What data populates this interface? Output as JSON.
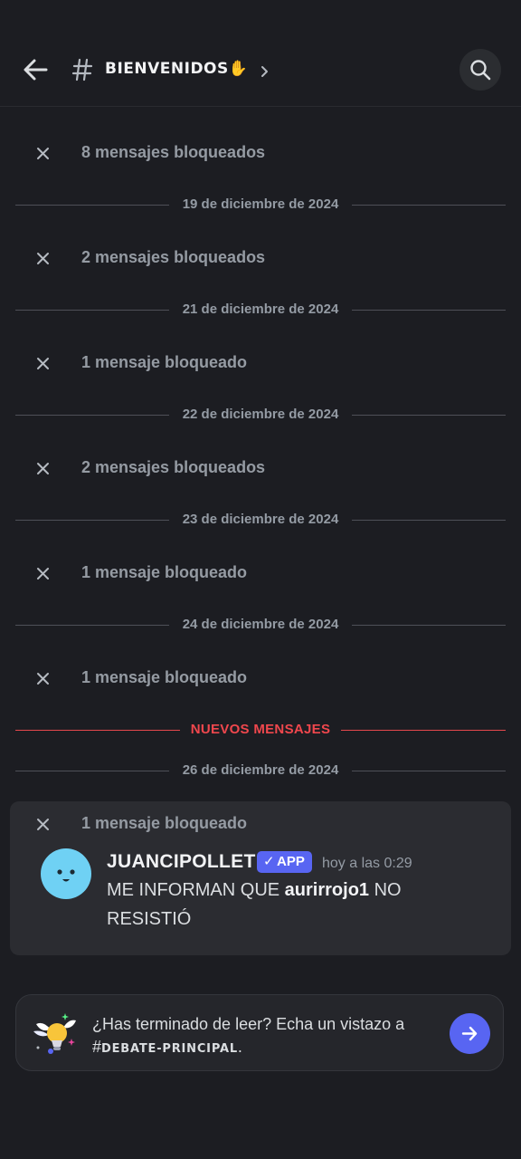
{
  "header": {
    "channel_name": "BIENVENIDOS✋"
  },
  "feed": {
    "blocked_groups": [
      "8 mensajes bloqueados",
      "2 mensajes bloqueados",
      "1 mensaje bloqueado",
      "2 mensajes bloqueados",
      "1 mensaje bloqueado",
      "1 mensaje bloqueado",
      "1 mensaje bloqueado"
    ],
    "dates": [
      "19 de diciembre de 2024",
      "21 de diciembre de 2024",
      "22 de diciembre de 2024",
      "23 de diciembre de 2024",
      "24 de diciembre de 2024",
      "26 de diciembre de 2024"
    ],
    "new_messages_label": "NUEVOS MENSAJES"
  },
  "message": {
    "author": "JUANCIPOLLET",
    "badge_check": "✓",
    "badge": "APP",
    "timestamp": "hoy a las 0:29",
    "text_before": "ME INFORMAN QUE ",
    "mention": "aurirrojo1",
    "text_after": " NO",
    "text_line2": "RESISTIÓ",
    "avatar_color": "#6fd1f4"
  },
  "read_banner": {
    "line1": "¿Has terminado de leer? Echa un vistazo a",
    "hash": "#",
    "channel": "DEBATE-PRINCIPAL",
    "period": "."
  },
  "colors": {
    "background": "#1c1d22",
    "accent": "#5865f2",
    "new_messages": "#f0474d"
  }
}
